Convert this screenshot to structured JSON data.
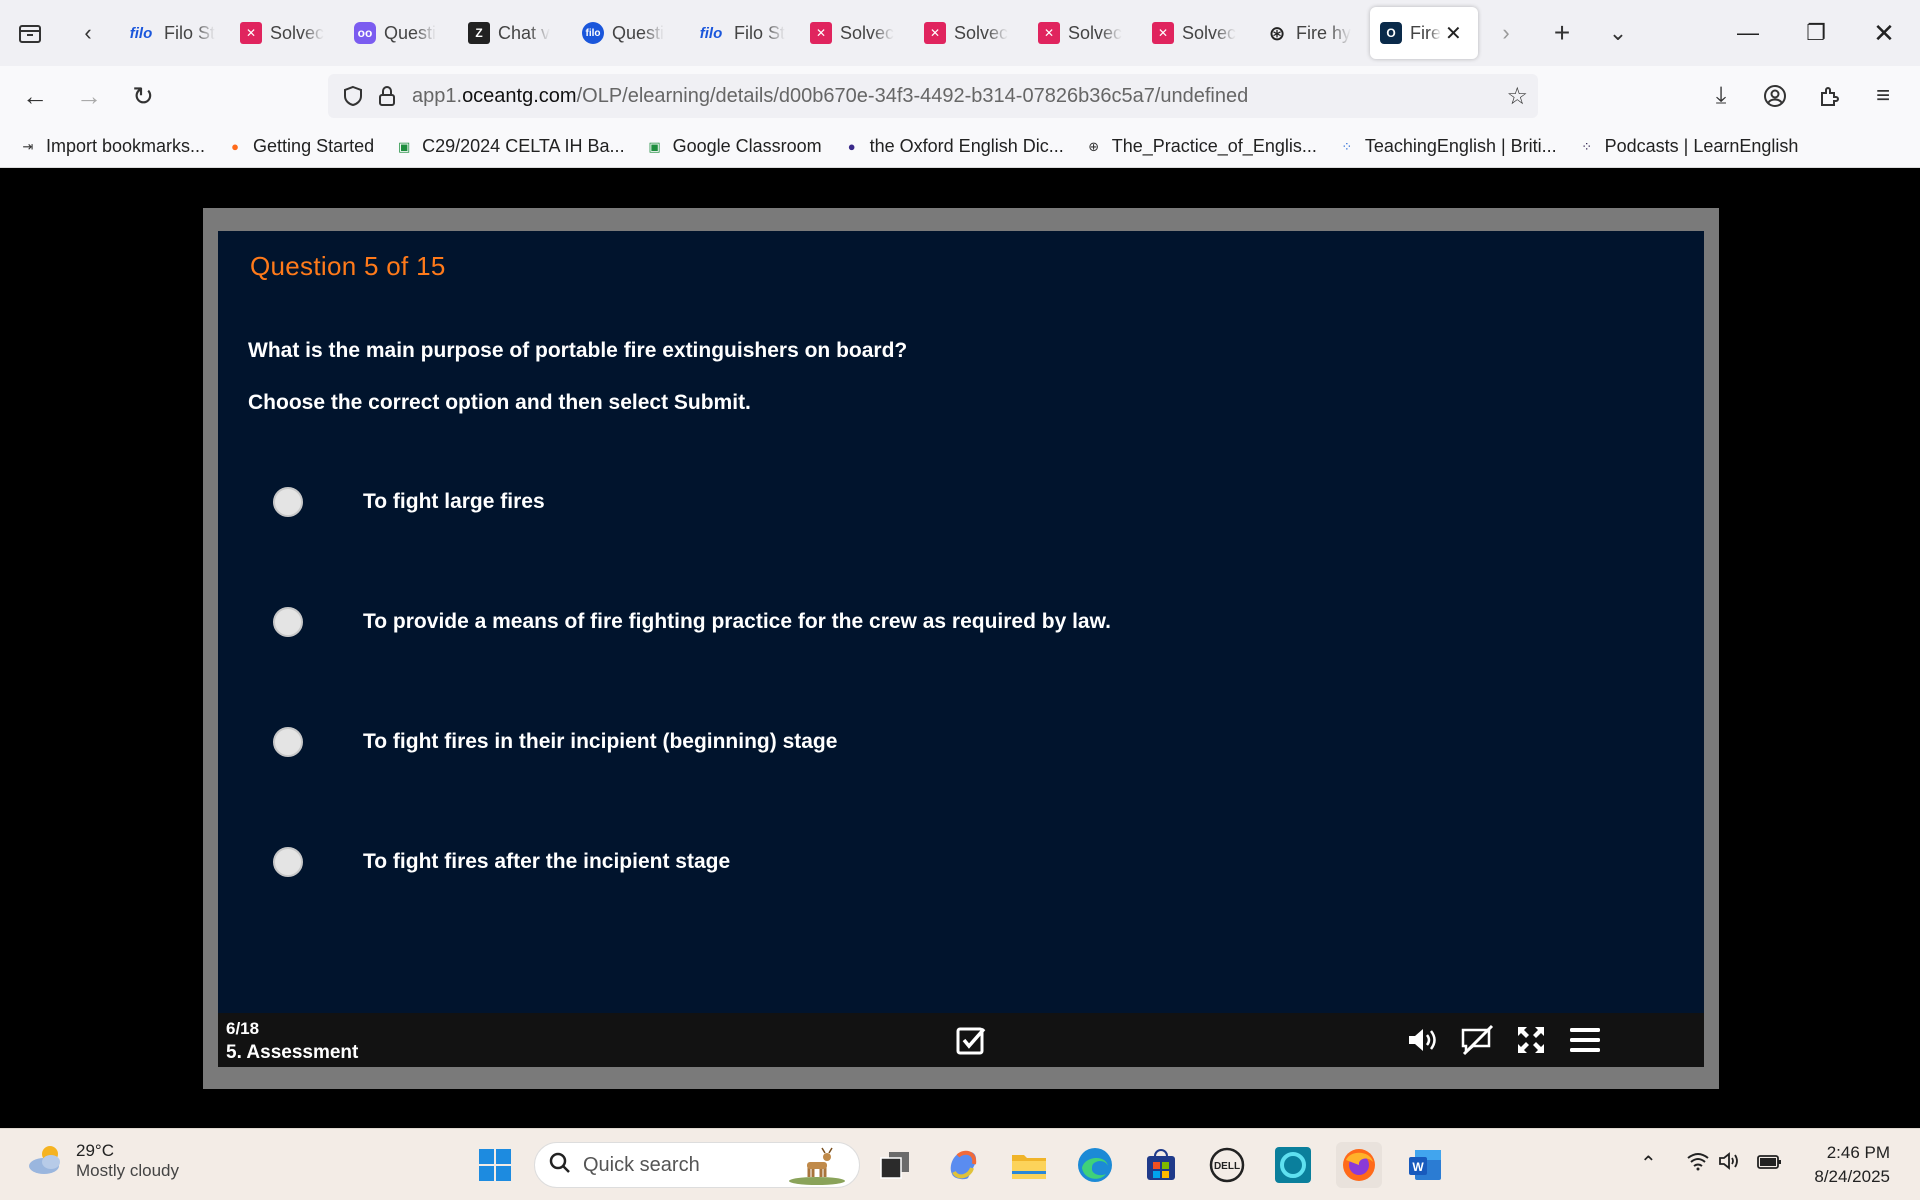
{
  "browser": {
    "tabs": [
      {
        "label": "Filo St",
        "favicon": "filo"
      },
      {
        "label": "Solvec",
        "favicon": "x"
      },
      {
        "label": "Questi",
        "favicon": "owl"
      },
      {
        "label": "Chat v",
        "favicon": "z"
      },
      {
        "label": "Questi",
        "favicon": "filoc"
      },
      {
        "label": "Filo St",
        "favicon": "filo"
      },
      {
        "label": "Solvec",
        "favicon": "x"
      },
      {
        "label": "Solvec",
        "favicon": "x"
      },
      {
        "label": "Solvec",
        "favicon": "x"
      },
      {
        "label": "Solvec",
        "favicon": "x"
      },
      {
        "label": "Fire hy",
        "favicon": "gpt"
      },
      {
        "label": "Fire",
        "favicon": "ocean",
        "active": true
      }
    ],
    "favicon_text": {
      "filo": "filo",
      "x": "✕",
      "owl": "oo",
      "z": "Z",
      "filoc": "filo",
      "gpt": "⊛",
      "ocean": "O"
    },
    "url": {
      "prefix": "app1.",
      "domain": "oceantg.com",
      "path": "/OLP/elearning/details/d00b670e-34f3-4492-b314-07826b36c5a7/undefined"
    },
    "bookmarks": [
      {
        "label": "Import bookmarks...",
        "icon": "import-icon",
        "glyph": "⇥",
        "color": "#333"
      },
      {
        "label": "Getting Started",
        "icon": "firefox-icon",
        "glyph": "●",
        "color": "#ff6a1a"
      },
      {
        "label": "C29/2024 CELTA IH Ba...",
        "icon": "classroom-icon",
        "glyph": "▣",
        "color": "#1e8e3e"
      },
      {
        "label": "Google Classroom",
        "icon": "classroom-icon",
        "glyph": "▣",
        "color": "#1e8e3e"
      },
      {
        "label": "the Oxford English Dic...",
        "icon": "oed-icon",
        "glyph": "●",
        "color": "#3a2a8a"
      },
      {
        "label": "The_Practice_of_Englis...",
        "icon": "globe-icon",
        "glyph": "⊕",
        "color": "#333"
      },
      {
        "label": "TeachingEnglish | Briti...",
        "icon": "british-council-icon",
        "glyph": "⁘",
        "color": "#2b6cd8"
      },
      {
        "label": "Podcasts | LearnEnglish",
        "icon": "british-council-icon",
        "glyph": "⁘",
        "color": "#2a1a4a"
      }
    ]
  },
  "quiz": {
    "title": "Question  5  of 15",
    "question": "What is the main purpose of portable fire extinguishers on board?",
    "instruction": "Choose the correct option and then select Submit.",
    "options": [
      "To fight large fires",
      "To provide a means of fire fighting practice for the crew as required by law.",
      "To fight fires in their incipient (beginning) stage",
      "To fight fires after the incipient stage"
    ],
    "slide_count": "6/18",
    "slide_name": "5. Assessment"
  },
  "colors": {
    "slide_bg": "#01142d",
    "title_orange": "#ff7a1a"
  },
  "taskbar": {
    "weather_temp": "29°C",
    "weather_desc": "Mostly cloudy",
    "search_placeholder": "Quick search",
    "time": "2:46 PM",
    "date": "8/24/2025"
  }
}
